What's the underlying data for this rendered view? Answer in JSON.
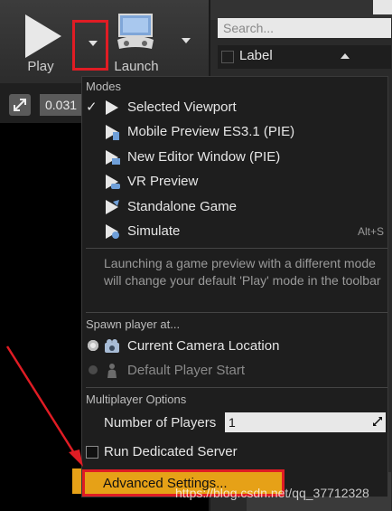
{
  "toolbar": {
    "play_label": "Play",
    "launch_label": "Launch"
  },
  "viewport": {
    "value": "0.031"
  },
  "right_panel": {
    "search_placeholder": "Search...",
    "label_header": "Label"
  },
  "menu": {
    "modes_header": "Modes",
    "modes": [
      {
        "label": "Selected Viewport",
        "checked": true,
        "icon": "play-viewport-icon"
      },
      {
        "label": "Mobile Preview ES3.1 (PIE)",
        "icon": "mobile-preview-icon"
      },
      {
        "label": "New Editor Window (PIE)",
        "icon": "new-window-icon"
      },
      {
        "label": "VR Preview",
        "icon": "vr-preview-icon"
      },
      {
        "label": "Standalone Game",
        "icon": "standalone-game-icon"
      },
      {
        "label": "Simulate",
        "shortcut": "Alt+S",
        "icon": "simulate-icon"
      }
    ],
    "description": "Launching a game preview with a different mode will change your default 'Play' mode in the toolbar",
    "spawn_header": "Spawn player at...",
    "spawn": [
      {
        "label": "Current Camera Location",
        "selected": true
      },
      {
        "label": "Default Player Start",
        "selected": false
      }
    ],
    "multiplayer_header": "Multiplayer Options",
    "num_players_label": "Number of Players",
    "num_players_value": "1",
    "dedicated_server_label": "Run Dedicated Server",
    "advanced_label": "Advanced Settings..."
  },
  "watermark": "https://blog.csdn.net/qq_37712328",
  "colors": {
    "highlight": "#e01c24",
    "accent": "#e6a117"
  }
}
